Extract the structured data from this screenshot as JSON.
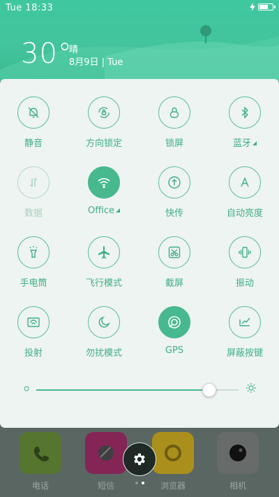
{
  "status_bar": {
    "day": "Tue",
    "time": "18:33"
  },
  "weather": {
    "temperature": "30°",
    "condition": "晴",
    "date": "8月9日 | Tue"
  },
  "toggles": [
    {
      "label": "静音",
      "icon": "bell-off-icon",
      "state": "off"
    },
    {
      "label": "方向锁定",
      "icon": "rotation-lock-icon",
      "state": "off"
    },
    {
      "label": "锁屏",
      "icon": "lock-icon",
      "state": "off"
    },
    {
      "label": "蓝牙",
      "icon": "bluetooth-icon",
      "state": "off",
      "has_menu": true
    },
    {
      "label": "数据",
      "icon": "data-arrows-icon",
      "state": "disabled"
    },
    {
      "label": "Office",
      "icon": "wifi-icon",
      "state": "on",
      "has_menu": true
    },
    {
      "label": "快传",
      "icon": "quick-transfer-icon",
      "state": "off"
    },
    {
      "label": "自动亮度",
      "icon": "auto-brightness-icon",
      "state": "off"
    },
    {
      "label": "手电筒",
      "icon": "flashlight-icon",
      "state": "off"
    },
    {
      "label": "飞行模式",
      "icon": "airplane-icon",
      "state": "off"
    },
    {
      "label": "截屏",
      "icon": "screenshot-scissors-icon",
      "state": "off"
    },
    {
      "label": "振动",
      "icon": "vibrate-icon",
      "state": "off"
    },
    {
      "label": "投射",
      "icon": "cast-icon",
      "state": "off"
    },
    {
      "label": "勿扰模式",
      "icon": "moon-icon",
      "state": "off"
    },
    {
      "label": "GPS",
      "icon": "gps-icon",
      "state": "on"
    },
    {
      "label": "屏蔽按键",
      "icon": "block-keys-icon",
      "state": "off"
    }
  ],
  "brightness": {
    "level_percent": 85
  },
  "dock": {
    "apps": [
      {
        "label": "电话",
        "icon": "phone-icon",
        "color": "#5a7a2e"
      },
      {
        "label": "短信",
        "icon": "message-icon",
        "color": "#8b2a5b"
      },
      {
        "label": "浏览器",
        "icon": "browser-icon",
        "color": "#b4981f"
      },
      {
        "label": "相机",
        "icon": "camera-icon",
        "color": "#6b6f6d"
      }
    ],
    "page_count": 2,
    "active_page": 2
  },
  "colors": {
    "accent": "#48b88f",
    "header_green": "#3fc8a0",
    "panel_bg": "#eef4f1"
  }
}
